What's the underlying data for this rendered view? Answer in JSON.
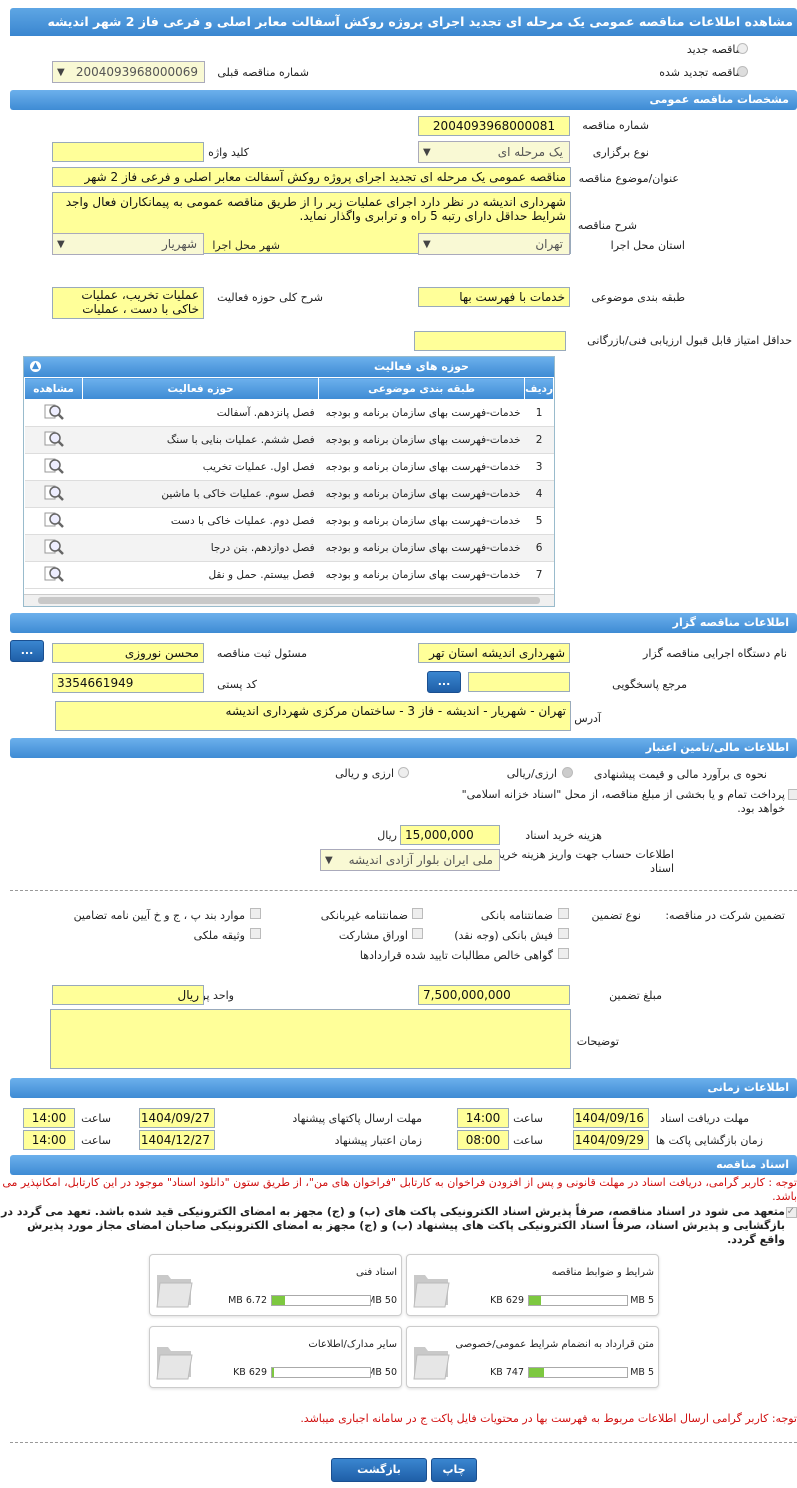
{
  "title": "مشاهده اطلاعات مناقصه عمومی یک مرحله ای تجدید اجرای پروژه روکش آسفالت معابر اصلی و فرعی فاز 2 شهر اندیشه",
  "top": {
    "radio_new": "مناقصه جدید",
    "radio_renewed": "مناقصه تجدید شده",
    "prev_label": "شماره مناقصه قبلی",
    "prev_value": "2004093968000069"
  },
  "general": {
    "header": "مشخصات مناقصه عمومی",
    "number_label": "شماره مناقصه",
    "number": "2004093968000081",
    "organizer_label": "نوع برگزاری",
    "organizer": "یک مرحله ای",
    "keyword_label": "کلید واژه",
    "keyword": "",
    "subject_label": "عنوان/موضوع مناقصه",
    "subject": "مناقصه عمومی یک مرحله ای تجدید اجرای پروژه روکش آسفالت معابر اصلی و فرعی فاز 2 شهر",
    "desc_label": "شرح مناقصه",
    "desc": "شهرداری اندیشه در نظر دارد اجرای عملیات زیر را  از طریق مناقصه عمومی به پیمانکاران فعال واجد شرایط حداقل دارای رتبه 5 راه و ترابری واگذار نماید.",
    "province_label": "استان محل اجرا",
    "province": "تهران",
    "city_label": "شهر محل اجرا",
    "city": "شهریار",
    "category_label": "طبقه بندی موضوعی",
    "category": "خدمات با فهرست بها",
    "activity_label": "شرح کلی حوزه فعالیت",
    "activity": "عملیات تخریب، عملیات خاکی با دست ، عملیات",
    "min_score_label": "حداقل امتیاز قابل قبول ارزیابی فنی/بازرگانی",
    "min_score": ""
  },
  "activities": {
    "header": "حوزه های فعالیت",
    "cols": [
      "ردیف",
      "طبقه بندی موضوعی",
      "حوزه فعالیت",
      "مشاهده"
    ],
    "rows": [
      {
        "n": "1",
        "cat": "خدمات-فهرست بهای سازمان برنامه و بودجه",
        "area": "فصل پانزدهم. آسفالت"
      },
      {
        "n": "2",
        "cat": "خدمات-فهرست بهای سازمان برنامه و بودجه",
        "area": "فصل ششم. عملیات بنایی با سنگ"
      },
      {
        "n": "3",
        "cat": "خدمات-فهرست بهای سازمان برنامه و بودجه",
        "area": "فصل اول. عملیات تخریب"
      },
      {
        "n": "4",
        "cat": "خدمات-فهرست بهای سازمان برنامه و بودجه",
        "area": "فصل سوم. عملیات خاکی با ماشین"
      },
      {
        "n": "5",
        "cat": "خدمات-فهرست بهای سازمان برنامه و بودجه",
        "area": "فصل دوم. عملیات خاکی با دست"
      },
      {
        "n": "6",
        "cat": "خدمات-فهرست بهای سازمان برنامه و بودجه",
        "area": "فصل دوازدهم. بتن درجا"
      },
      {
        "n": "7",
        "cat": "خدمات-فهرست بهای سازمان برنامه و بودجه",
        "area": "فصل بیستم. حمل و نقل"
      }
    ]
  },
  "organizer": {
    "header": "اطلاعات مناقصه گزار",
    "org_label": "نام دستگاه اجرایی مناقصه گزار",
    "org": "شهرداری اندیشه استان تهر",
    "resp_label": "مسئول ثبت مناقصه",
    "resp": "محسن نوروزی",
    "ref_label": "مرجع پاسخگویی",
    "ref": "",
    "postal_label": "کد پستی",
    "postal": "3354661949",
    "addr_label": "آدرس",
    "addr": "تهران - شهریار - اندیشه - فاز 3 - ساختمان مرکزی شهرداری اندیشه",
    "dots": "..."
  },
  "finance": {
    "header": "اطلاعات مالی/تامین اعتبار",
    "est_label": "نحوه ی برآورد مالی و قیمت پیشنهادی",
    "opt1": "ارزی/ریالی",
    "opt2": "ارزی و ریالی",
    "treasury": "پرداخت تمام و یا بخشی از مبلغ مناقصه، از محل \"اسناد خزانه اسلامی\" خواهد بود.",
    "doc_fee_label": "هزینه خرید اسناد",
    "doc_fee": "15,000,000",
    "rial": "ریال",
    "account_label": "اطلاعات حساب جهت واریز هزینه خرید اسناد",
    "account": "ملی ایران بلوار آزادی اندیشه"
  },
  "guarantee": {
    "label": "تضمین شرکت در مناقصه:",
    "type_label": "نوع تضمین",
    "o1": "ضمانتنامه بانکی",
    "o2": "ضمانتنامه غیربانکی",
    "o3": "موارد بند پ ، ج و خ آیین نامه تضامین",
    "o4": "فیش بانکی (وجه نقد)",
    "o5": "اوراق مشارکت",
    "o6": "وثیقه ملکی",
    "o7": "گواهی خالص مطالبات تایید شده قراردادها",
    "amount_label": "مبلغ تضمین",
    "amount": "7,500,000,000",
    "unit_label": "واحد پول",
    "unit": "ریال",
    "notes_label": "توضیحات"
  },
  "timing": {
    "header": "اطلاعات زمانی",
    "recv_label": "مهلت دریافت اسناد",
    "recv_date": "1404/09/16",
    "recv_time": "14:00",
    "send_label": "مهلت ارسال پاکتهای پیشنهاد",
    "send_date": "1404/09/27",
    "send_time": "14:00",
    "open_label": "زمان بازگشایی پاکت ها",
    "open_date": "1404/09/29",
    "open_time": "08:00",
    "valid_label": "زمان اعتبار پیشنهاد",
    "valid_date": "1404/12/27",
    "valid_time": "14:00",
    "time_label": "ساعت"
  },
  "docs": {
    "header": "اسناد مناقصه",
    "note1": "توجه : کاربر گرامی، دریافت اسناد در مهلت قانونی و پس از افزودن فراخوان به کارتابل \"فراخوان های من\"، از طریق ستون \"دانلود اسناد\" موجود در این کارتابل، امکانپذیر می باشد.",
    "note2": "متعهد می شود در اسناد مناقصه، صرفاً پذیرش اسناد الکترونیکی پاکت های (ب) و (ج) مجهز به امضای الکترونیکی قید شده باشد. تعهد می گردد در بازگشایی و پذیرش اسناد، صرفاً اسناد الکترونیکی پاکت های پیشنهاد (ب) و (ج) مجهز به امضای الکترونیکی صاحبان امضای مجاز مورد پذیرش واقع گردد.",
    "files": [
      {
        "name": "شرایط و ضوابط مناقصه",
        "size": "629 KB",
        "max": "5 MB",
        "pct": 12
      },
      {
        "name": "اسناد فنی",
        "size": "6.72 MB",
        "max": "50 MB",
        "pct": 13
      },
      {
        "name": "متن قرارداد به انضمام شرایط عمومی/خصوصی",
        "size": "747 KB",
        "max": "5 MB",
        "pct": 15
      },
      {
        "name": "سایر مدارک/اطلاعات",
        "size": "629 KB",
        "max": "50 MB",
        "pct": 2
      }
    ],
    "note3": "توجه: کاربر گرامی ارسال اطلاعات مربوط به فهرست بها در محتویات فایل پاکت ج در سامانه اجباری میباشد."
  },
  "buttons": {
    "print": "چاپ",
    "back": "بازگشت"
  }
}
